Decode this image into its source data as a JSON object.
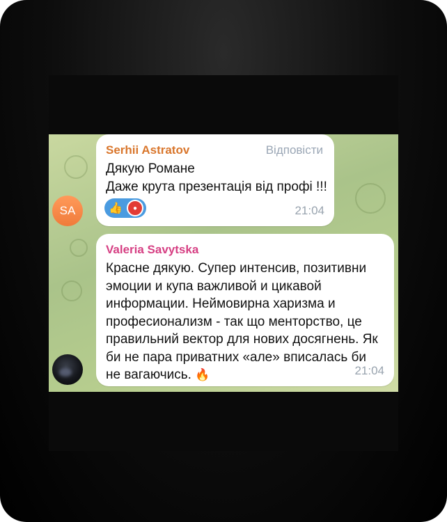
{
  "messages": [
    {
      "avatar_initials": "SA",
      "sender": "Serhii Astratov",
      "reply_label": "Відповісти",
      "line1": "Дякую Романе",
      "line2": "Даже крута презентація від профі !!!",
      "reactions": [
        "thumbs-up-icon",
        "reactor-avatar"
      ],
      "time": "21:04"
    },
    {
      "sender": "Valeria Savytska",
      "text": "Красне дякую. Супер интенсив, позитивни эмоции и купа важливой и цикавой информации. Неймовирна харизма и професионализм - так що менторство, це правильний вектор для нових досягнень. Як би не пара приватних «але» вписалась би не вагаючись.",
      "emoji": "🔥",
      "time": "21:04"
    }
  ],
  "colors": {
    "sender1": "#d9762c",
    "sender2": "#d63f83",
    "reaction_bg": "#4a9be0"
  }
}
